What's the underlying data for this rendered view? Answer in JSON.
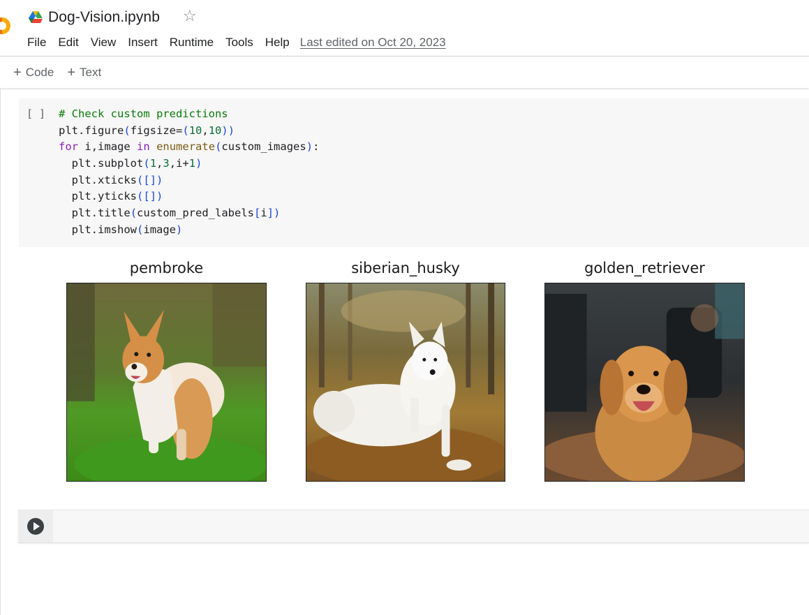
{
  "notebook": {
    "title": "Dog-Vision.ipynb"
  },
  "menu": {
    "items": [
      "File",
      "Edit",
      "View",
      "Insert",
      "Runtime",
      "Tools",
      "Help"
    ],
    "last_edited": "Last edited on Oct 20, 2023"
  },
  "toolbar": {
    "code_label": "Code",
    "text_label": "Text"
  },
  "code_cell": {
    "execution_count": "[ ]",
    "lines": [
      "# Check custom predictions",
      "plt.figure(figsize=(10,10))",
      "for i,image in enumerate(custom_images):",
      "  plt.subplot(1,3,i+1)",
      "  plt.xticks([])",
      "  plt.yticks([])",
      "  plt.title(custom_pred_labels[i])",
      "  plt.imshow(image)"
    ]
  },
  "output": {
    "subplots": [
      {
        "title": "pembroke",
        "image": "corgi-photo"
      },
      {
        "title": "siberian_husky",
        "image": "husky-photo"
      },
      {
        "title": "golden_retriever",
        "image": "golden-retriever-photo"
      }
    ]
  },
  "colors": {
    "comment": "#0b7a0b",
    "keyword": "#8a1fb8",
    "builtin": "#7b5a14",
    "paren": "#1a48d6",
    "number": "#0b6e3b",
    "colab_orange": "#f9ab00"
  }
}
